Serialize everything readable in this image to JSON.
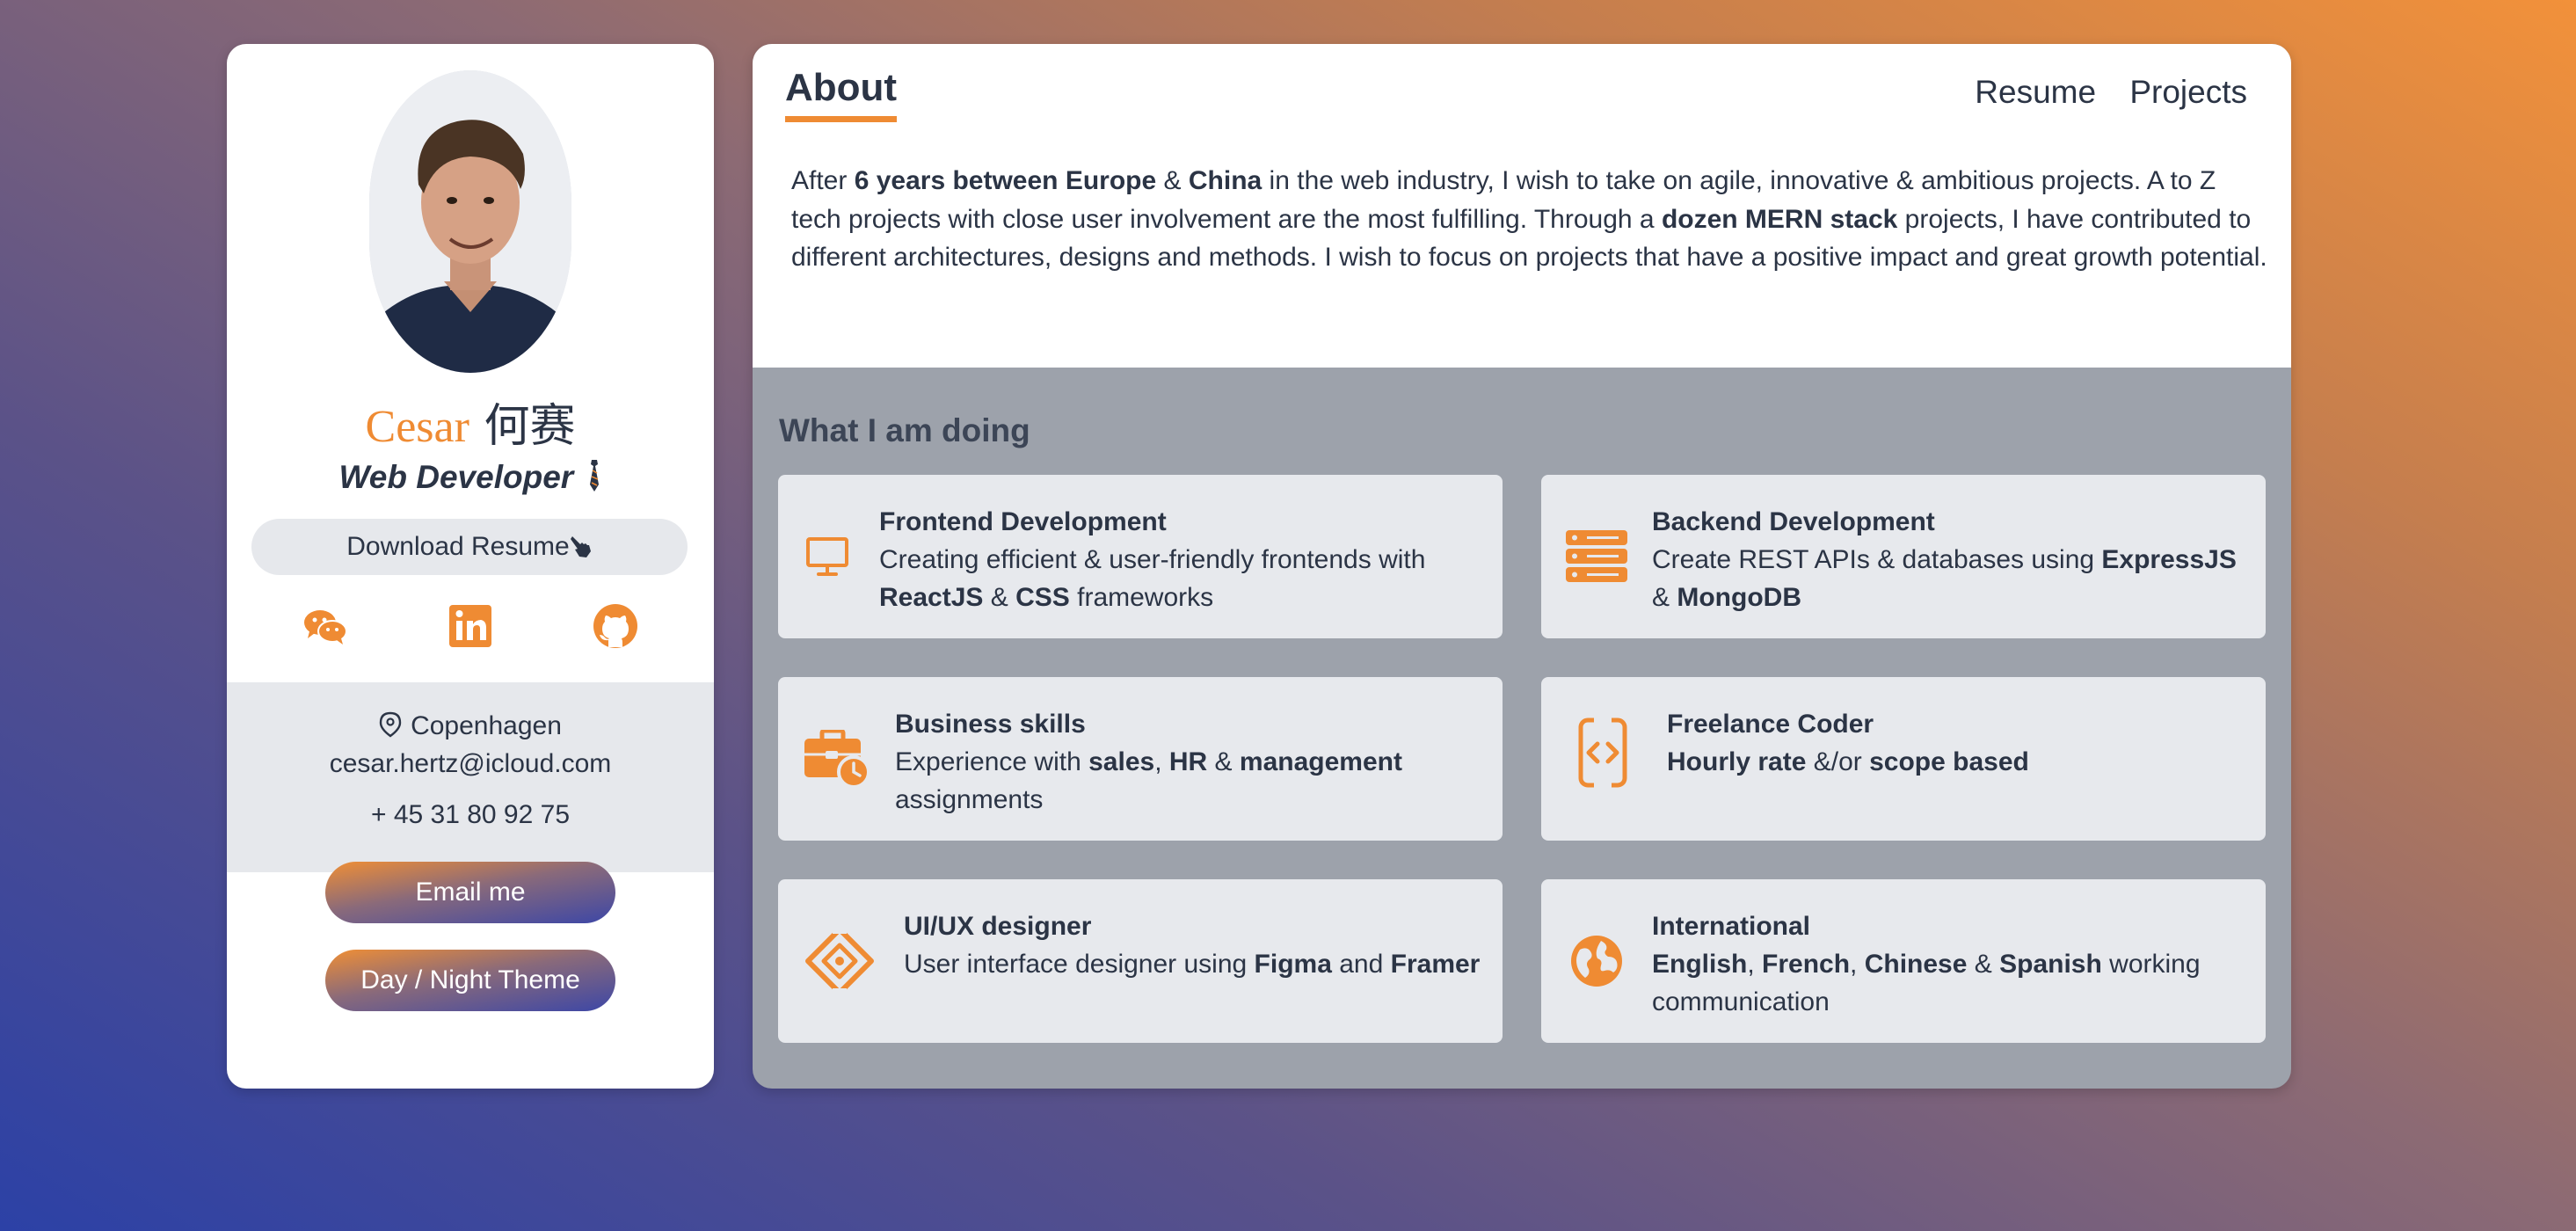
{
  "profile": {
    "name_latin": "Cesar",
    "name_cjk": "何赛",
    "role": "Web Developer",
    "download_label": "Download Resume",
    "socials": [
      {
        "icon": "wechat-icon"
      },
      {
        "icon": "linkedin-icon"
      },
      {
        "icon": "github-icon"
      }
    ],
    "contact": {
      "location": "Copenhagen",
      "email": "cesar.hertz@icloud.com",
      "phone": "+ 45 31 80 92 75"
    },
    "email_button": "Email me",
    "theme_button": "Day / Night Theme"
  },
  "header": {
    "title": "About",
    "nav": [
      "Resume",
      "Projects"
    ]
  },
  "about": {
    "p1": "After ",
    "b1": "6 years between Europe",
    "p2": " & ",
    "b2": "China",
    "p3": " in the web industry, I wish to take on agile, innovative & ambitious projects. A to Z tech projects with close user involvement are the most fulfilling. Through a ",
    "b3": "dozen MERN stack",
    "p4": " projects, I have contributed to different architectures, designs and methods. I wish to focus on projects that have a positive impact and great growth potential."
  },
  "doing": {
    "title": "What I am doing",
    "cards": [
      {
        "title": "Frontend Development",
        "icon": "monitor-icon",
        "d1": "Creating efficient & user-friendly frontends with ",
        "b1": "ReactJS",
        "d2": " & ",
        "b2": "CSS",
        "d3": " frameworks"
      },
      {
        "title": "Backend Development",
        "icon": "server-icon",
        "d1": "Create REST APIs & databases using ",
        "b1": "ExpressJS",
        "d2": " & ",
        "b2": "MongoDB",
        "d3": ""
      },
      {
        "title": "Business skills",
        "icon": "briefcase-clock-icon",
        "d1": "Experience with ",
        "b1": "sales",
        "d2": ", ",
        "b2": "HR",
        "d3": " & ",
        "b3": "management",
        "d4": " assignments"
      },
      {
        "title": "Freelance Coder",
        "icon": "mobile-code-icon",
        "d1": "",
        "b1": "Hourly rate",
        "d2": " &/or ",
        "b2": "scope based",
        "d3": ""
      },
      {
        "title": "UI/UX designer",
        "icon": "diamond-icon",
        "d1": "User interface designer using ",
        "b1": "Figma",
        "d2": " and ",
        "b2": "Framer",
        "d3": ""
      },
      {
        "title": "International",
        "icon": "globe-icon",
        "d1": "",
        "b1": "English",
        "d2": ", ",
        "b2": "French",
        "d3": ", ",
        "b3": "Chinese",
        "d4": " & ",
        "b4": "Spanish",
        "d5": " working communication"
      }
    ]
  },
  "colors": {
    "accent": "#ef8b33",
    "text": "#2b3445",
    "panel_bg": "#9da2ab",
    "card_bg": "#e7e9ed"
  }
}
